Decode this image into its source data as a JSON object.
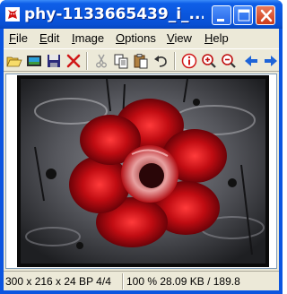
{
  "window": {
    "title": "phy-1133665439_i_...",
    "icon": "irfanview-cat-icon",
    "controls": [
      "minimize-icon",
      "maximize-icon",
      "close-icon"
    ]
  },
  "menu": {
    "file": "File",
    "edit": "Edit",
    "image": "Image",
    "options": "Options",
    "view": "View",
    "help": "Help"
  },
  "toolbar": {
    "icons": [
      "open-folder-icon",
      "slideshow-icon",
      "save-icon",
      "delete-icon",
      "cut-icon",
      "copy-icon",
      "paste-icon",
      "undo-icon",
      "info-icon",
      "zoom-in-icon",
      "zoom-out-icon",
      "previous-arrow-icon",
      "next-arrow-icon"
    ]
  },
  "image_view": {
    "content": "photo-red-flower-on-water"
  },
  "status": {
    "dimensions": "300 x 216 x 24 BP 4/4",
    "zoom_size": "100 %  28.09 KB / 189.8"
  },
  "colors": {
    "titlebar": "#0a56dd",
    "client_bg": "#ece9d8",
    "accent_red": "#c0001a"
  }
}
